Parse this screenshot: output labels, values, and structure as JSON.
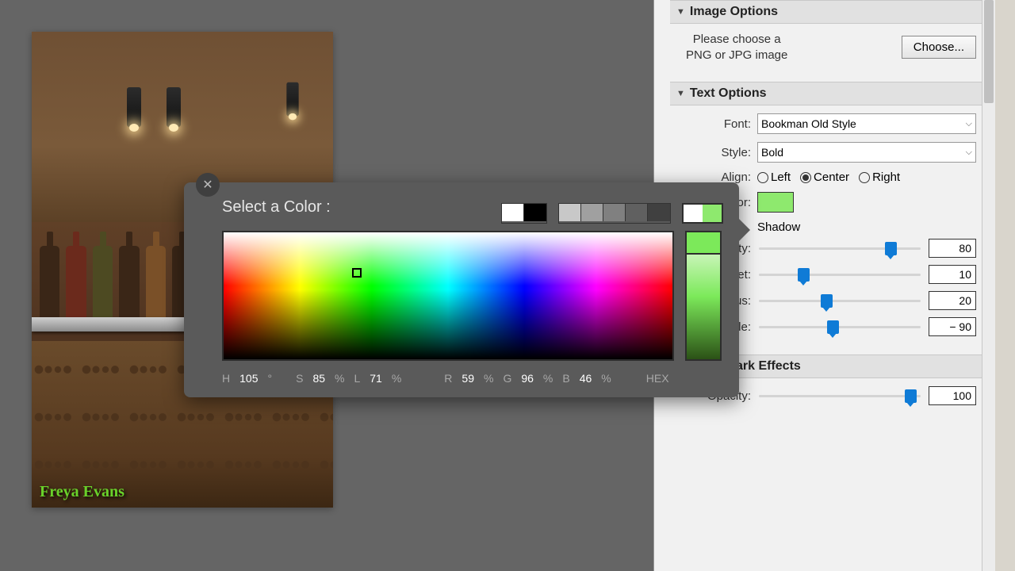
{
  "watermark_text": "Freya Evans",
  "panel": {
    "image_options": {
      "title": "Image Options",
      "hint_line1": "Please choose a",
      "hint_line2": "PNG or JPG image",
      "choose_btn": "Choose..."
    },
    "text_options": {
      "title": "Text Options",
      "font_label": "Font:",
      "font_value": "Bookman Old Style",
      "style_label": "Style:",
      "style_value": "Bold",
      "align_label": "Align:",
      "align_options": {
        "left": "Left",
        "center": "Center",
        "right": "Right"
      },
      "align_selected": "Center",
      "color_label": "Color:",
      "color_value": "#8ee96e",
      "shadow_label": "Shadow",
      "opacity_label": "Opacity:",
      "opacity_value": "80",
      "offset_label": "Offset:",
      "offset_value": "10",
      "radius_label": "Radius:",
      "radius_value": "20",
      "angle_label": "Angle:",
      "angle_value": "− 90"
    },
    "effects": {
      "title": "Watermark Effects",
      "opacity_label": "Opacity:",
      "opacity_value": "100"
    }
  },
  "picker": {
    "title": "Select a Color :",
    "bw_swatches": [
      "#ffffff",
      "#000000"
    ],
    "gray_swatches": [
      "#c8c8c8",
      "#a0a0a0",
      "#808080",
      "#606060",
      "#404040"
    ],
    "preview": {
      "old": "#ffffff",
      "new": "#8ee96e"
    },
    "hsl": {
      "H_lbl": "H",
      "H": "105",
      "deg": "°",
      "S_lbl": "S",
      "S": "85",
      "L_lbl": "L",
      "L": "71",
      "pct": "%"
    },
    "rgb": {
      "R_lbl": "R",
      "R": "59",
      "G_lbl": "G",
      "G": "96",
      "B_lbl": "B",
      "B": "46"
    },
    "hex_label": "HEX"
  },
  "slider_pos": {
    "opacity_shadow": 78,
    "offset": 24,
    "radius": 38,
    "angle": 42,
    "opacity_fx": 90
  }
}
